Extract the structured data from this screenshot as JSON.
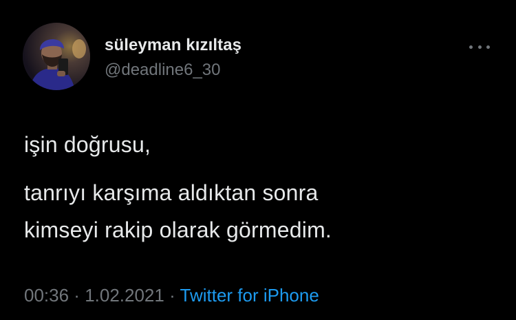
{
  "user": {
    "display_name": "süleyman kızıltaş",
    "handle": "@deadline6_30",
    "avatar_icon": "profile-photo"
  },
  "more_icon": "ellipsis-icon",
  "tweet": {
    "lines": [
      "işin doğrusu,",
      "tanrıyı karşıma aldıktan sonra",
      "kimseyi rakip olarak görmedim."
    ],
    "time": "00:36",
    "separator1": " · ",
    "date": "1.02.2021",
    "separator2": " · ",
    "source": "Twitter for iPhone"
  },
  "colors": {
    "background": "#000000",
    "text": "#e7e9ea",
    "secondary": "#71767b",
    "link": "#1d9bf0"
  }
}
